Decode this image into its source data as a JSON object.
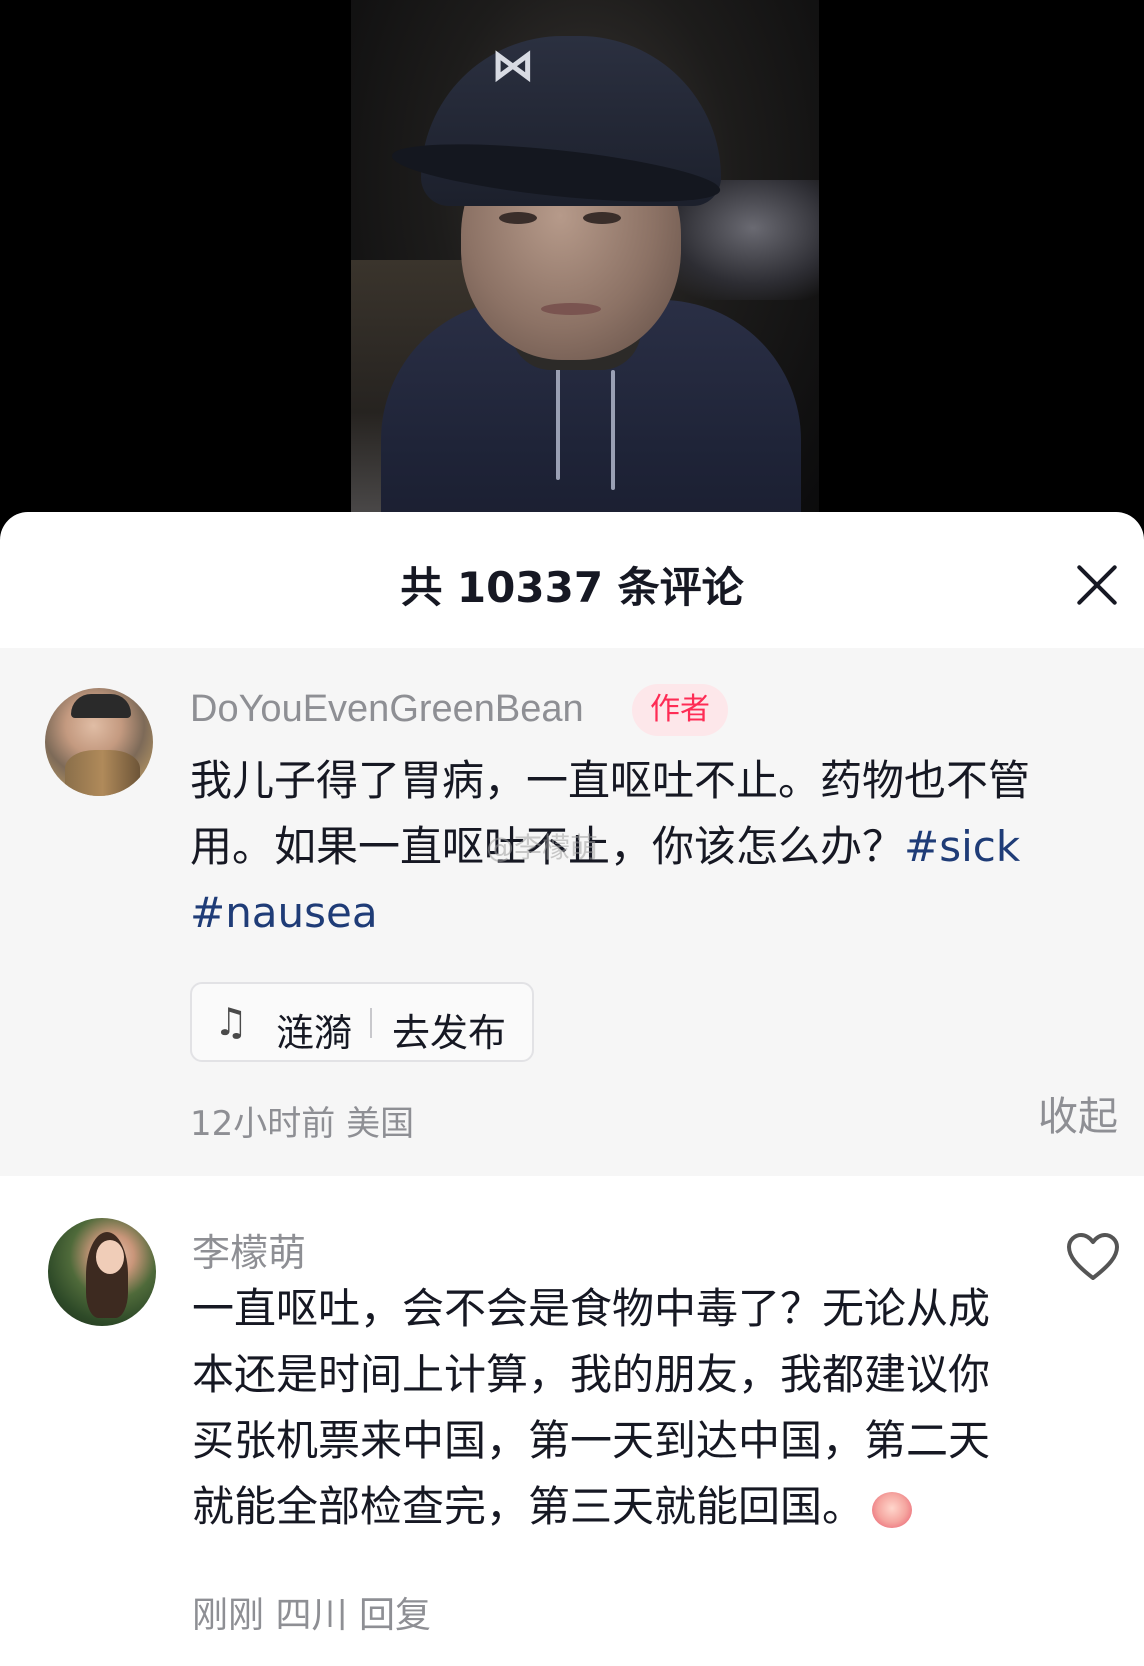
{
  "header": {
    "title": "共 10337 条评论"
  },
  "author_comment": {
    "username": "DoYouEvenGreenBean",
    "badge": "作者",
    "text": "我儿子得了胃病，一直呕吐不止。药物也不管用。如果一直呕吐不止，你该怎么办？",
    "hashtag_1": "#sick",
    "hashtag_2": "#nausea",
    "watermark": "@李檬萌",
    "music": {
      "icon": "music-note-icon",
      "title": "涟漪",
      "action": "去发布"
    },
    "meta": "12小时前 美国",
    "collapse_label": "收起"
  },
  "reply_comment": {
    "username": "李檬萌",
    "text": "一直呕吐，会不会是食物中毒了？无论从成本还是时间上计算，我的朋友，我都建议你买张机票来中国，第一天到达中国，第二天就能全部检查完，第三天就能回国。",
    "time": "刚刚",
    "location": "四川",
    "reply_label": "回复"
  },
  "colors": {
    "badge_text": "#fe2c55",
    "badge_bg": "#fde7ea",
    "hashtag": "#1f3c77",
    "secondary_text": "#8e8f94"
  }
}
